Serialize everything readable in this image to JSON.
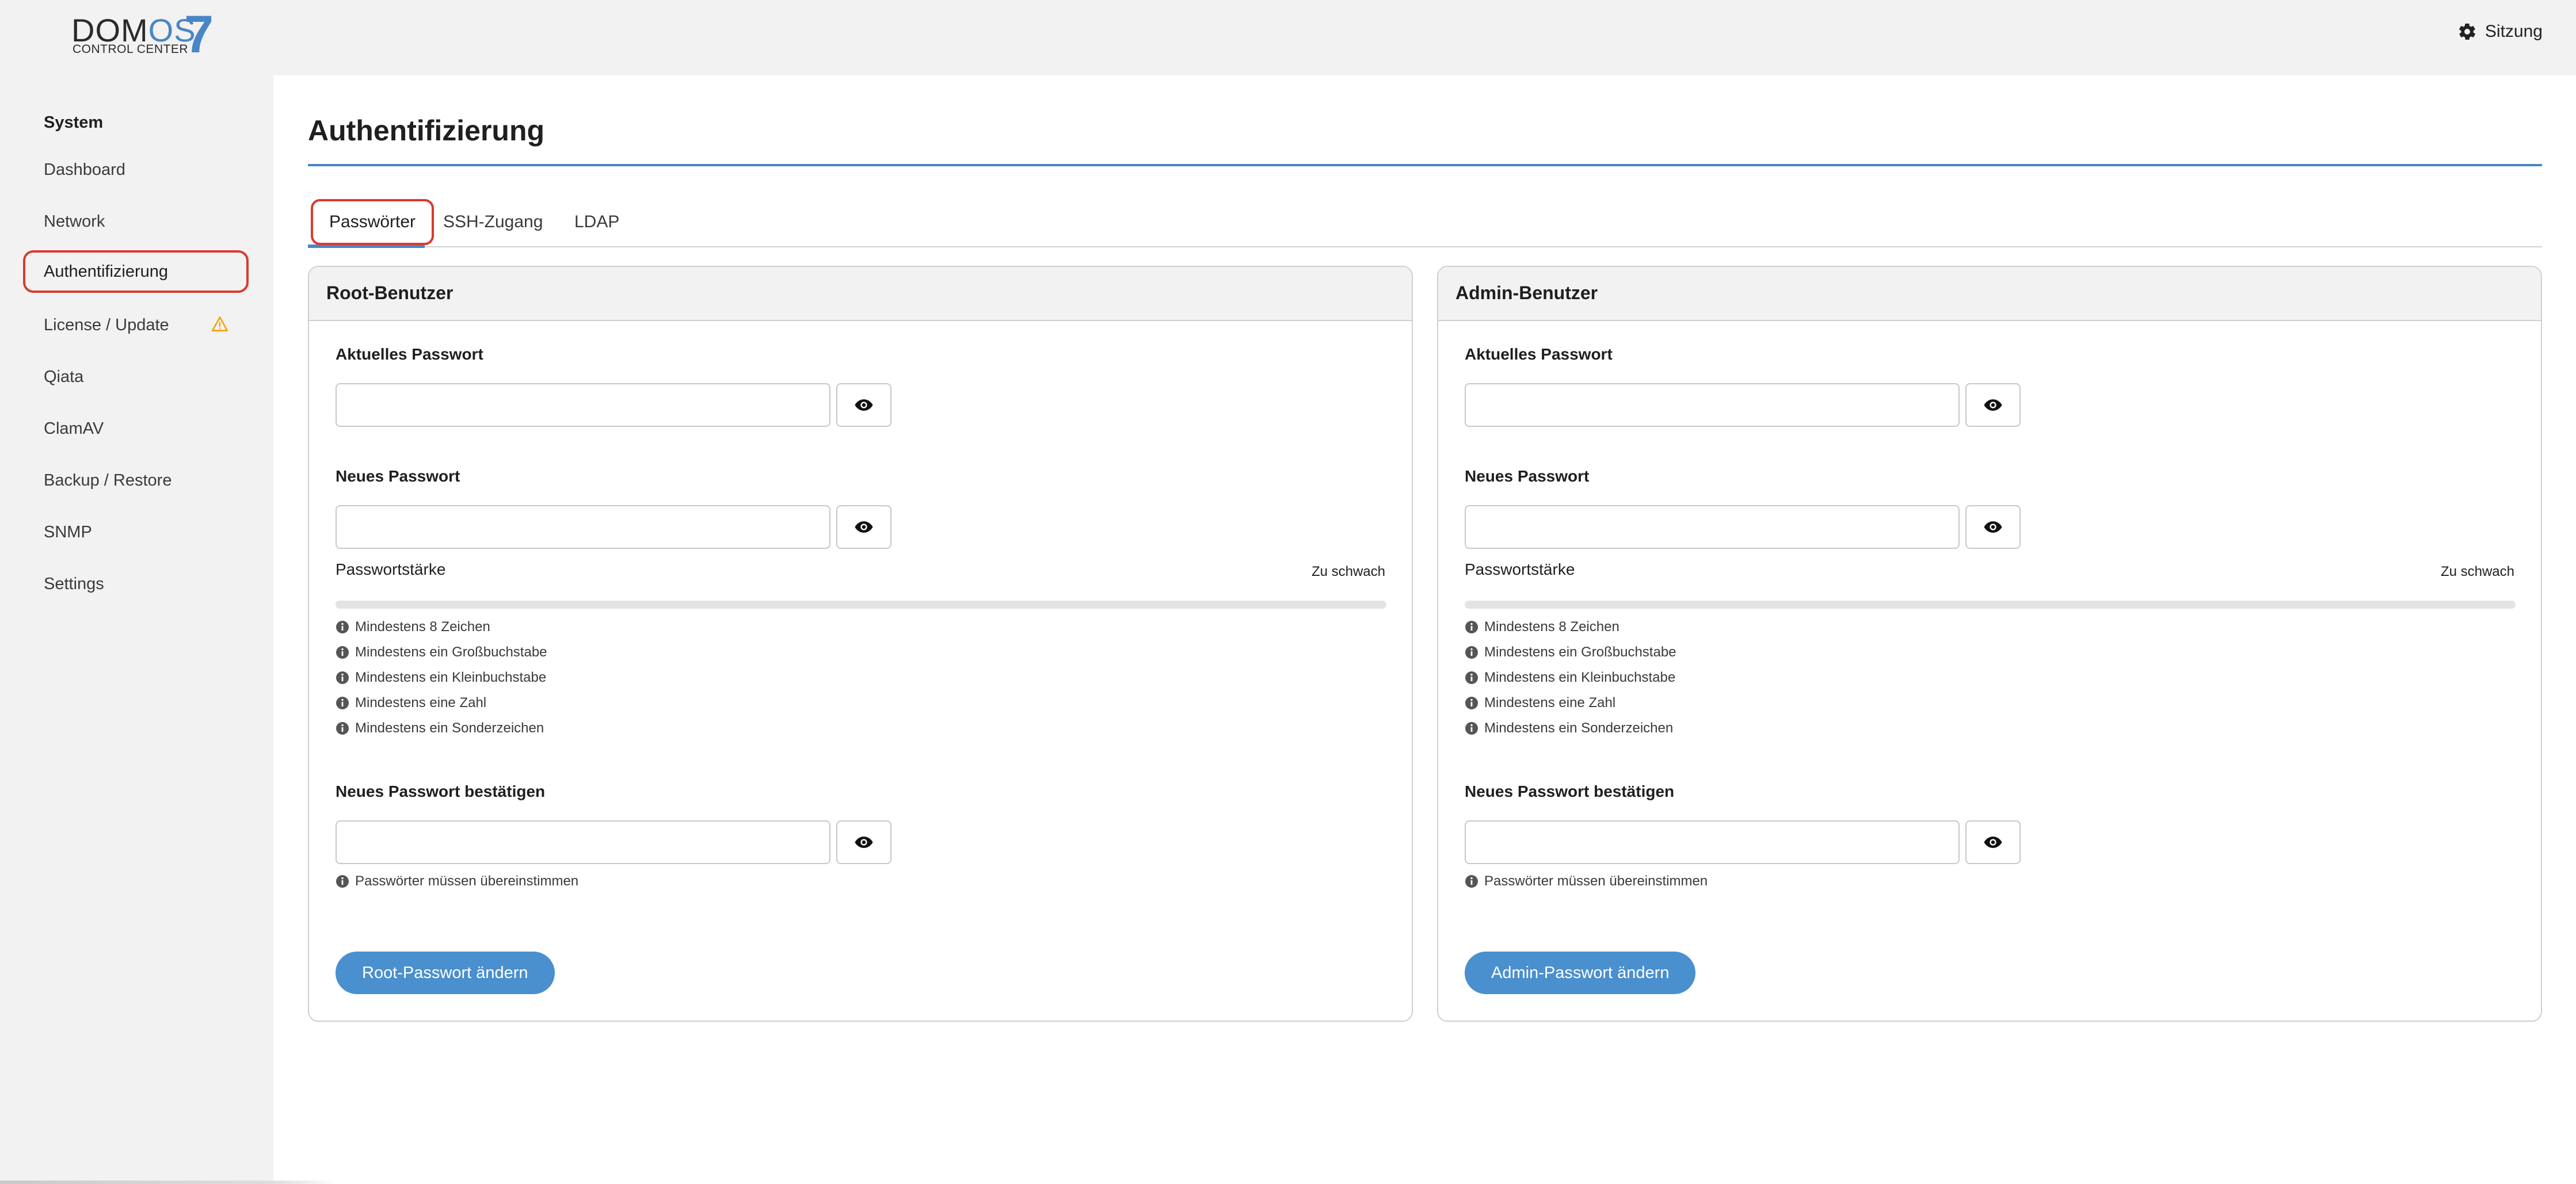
{
  "header": {
    "logo": {
      "word_main": "DOM",
      "word_accent": "OS",
      "number": "7",
      "subtitle": "CONTROL CENTER"
    },
    "session_label": "Sitzung",
    "session_icon": "gear-icon"
  },
  "sidebar": {
    "section_title": "System",
    "items": [
      {
        "label": "Dashboard",
        "active": false
      },
      {
        "label": "Network",
        "active": false
      },
      {
        "label": "Authentifizierung",
        "active": true
      },
      {
        "label": "License / Update",
        "active": false,
        "icon": "warning-icon"
      },
      {
        "label": "Qiata",
        "active": false
      },
      {
        "label": "ClamAV",
        "active": false
      },
      {
        "label": "Backup / Restore",
        "active": false
      },
      {
        "label": "SNMP",
        "active": false
      },
      {
        "label": "Settings",
        "active": false
      }
    ]
  },
  "main": {
    "title": "Authentifizierung",
    "tabs": [
      {
        "label": "Passwörter",
        "active": true
      },
      {
        "label": "SSH-Zugang",
        "active": false
      },
      {
        "label": "LDAP",
        "active": false
      }
    ],
    "cards": [
      {
        "title": "Root-Benutzer",
        "current_label": "Aktuelles Passwort",
        "current_value": "",
        "new_label": "Neues Passwort",
        "new_value": "",
        "strength_label": "Passwortstärke",
        "strength_value": "Zu schwach",
        "strength_fraction": 0,
        "requirements": [
          "Mindestens 8 Zeichen",
          "Mindestens ein Großbuchstabe",
          "Mindestens ein Kleinbuchstabe",
          "Mindestens eine Zahl",
          "Mindestens ein Sonderzeichen"
        ],
        "confirm_label": "Neues Passwort bestätigen",
        "confirm_value": "",
        "match_hint": "Passwörter müssen übereinstimmen",
        "submit_label": "Root-Passwort ändern"
      },
      {
        "title": "Admin-Benutzer",
        "current_label": "Aktuelles Passwort",
        "current_value": "",
        "new_label": "Neues Passwort",
        "new_value": "",
        "strength_label": "Passwortstärke",
        "strength_value": "Zu schwach",
        "strength_fraction": 0,
        "requirements": [
          "Mindestens 8 Zeichen",
          "Mindestens ein Großbuchstabe",
          "Mindestens ein Kleinbuchstabe",
          "Mindestens eine Zahl",
          "Mindestens ein Sonderzeichen"
        ],
        "confirm_label": "Neues Passwort bestätigen",
        "confirm_value": "",
        "match_hint": "Passwörter müssen übereinstimmen",
        "submit_label": "Admin-Passwort ändern"
      }
    ]
  },
  "colors": {
    "accent": "#4a86c5",
    "button": "#4a8fce",
    "highlight": "#d93a2f",
    "warning": "#f0a30a",
    "chrome": "#f2f2f2"
  }
}
